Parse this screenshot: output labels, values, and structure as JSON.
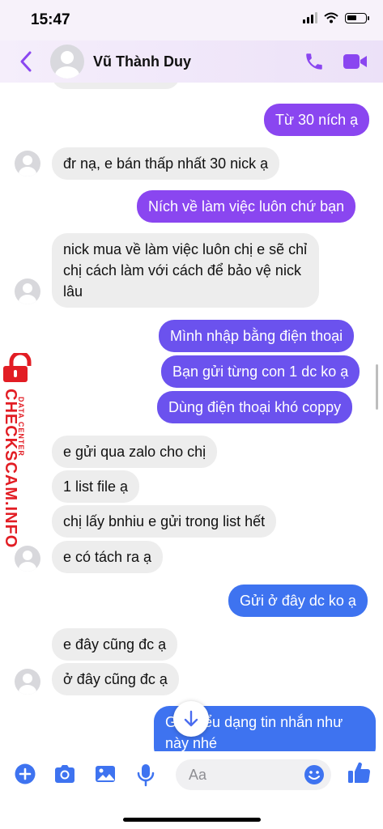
{
  "status_bar": {
    "time": "15:47",
    "battery_level": 0.55
  },
  "header": {
    "contact_name": "Vũ Thành Duy"
  },
  "messages": [
    {
      "dir": "out",
      "text": "Từ 30 ních ạ"
    },
    {
      "dir": "in",
      "text": "đr nạ, e bán thấp nhất 30 nick ạ"
    },
    {
      "dir": "out",
      "text": "Ních về làm việc luôn chứ bạn"
    },
    {
      "dir": "in",
      "text": "nick mua về làm việc luôn chị e sẽ chỉ chị cách làm với cách để bảo vệ nick lâu"
    },
    {
      "dir": "out",
      "text": "Mình nhập bằng điện thoại"
    },
    {
      "dir": "out",
      "text": "Bạn gửi từng con 1 dc ko ạ"
    },
    {
      "dir": "out",
      "text": "Dùng điện thoại khó coppy"
    },
    {
      "dir": "in",
      "text": "e gửi qua zalo cho chị"
    },
    {
      "dir": "in",
      "text": "1 list file ạ"
    },
    {
      "dir": "in",
      "text": "chị lấy bnhiu e gửi trong list hết"
    },
    {
      "dir": "in",
      "text": "e có tách ra ạ"
    },
    {
      "dir": "out",
      "text": "Gửi ở đây dc ko ạ"
    },
    {
      "dir": "in",
      "text": "e đây cũng đc ạ"
    },
    {
      "dir": "in",
      "text": "ở đây cũng đc ạ"
    },
    {
      "dir": "out",
      "text": "Gửi kiểu dạng tin nhắn như này nhé"
    }
  ],
  "watermark": {
    "small": "DATA CENTER",
    "big": "CHECKSCAM.INFO"
  },
  "composer": {
    "placeholder": "Aa"
  },
  "icons": [
    "back-chevron-icon",
    "phone-icon",
    "video-camera-icon",
    "plus-icon",
    "camera-icon",
    "gallery-icon",
    "microphone-icon",
    "emoji-icon",
    "thumbs-up-icon",
    "arrow-down-icon",
    "lock-icon"
  ],
  "colors": {
    "accent": "#8a46f0",
    "mid": "#6b52ee",
    "blue": "#3e73f0",
    "incoming": "#ededed",
    "watermark": "#e21d24"
  }
}
